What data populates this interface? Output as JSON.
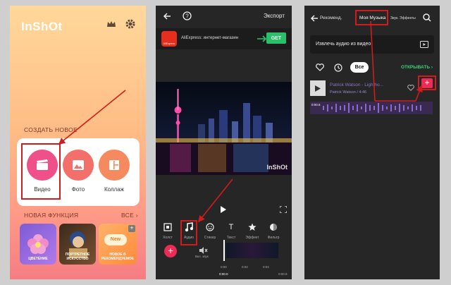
{
  "panel1": {
    "logo": "InShOt",
    "section_create": "СОЗДАТЬ НОВОЕ",
    "buttons": [
      {
        "label": "Видео"
      },
      {
        "label": "Фото"
      },
      {
        "label": "Коллаж"
      }
    ],
    "section_new": "НОВАЯ ФУНКЦИЯ",
    "see_all": "ВСЕ",
    "features": [
      {
        "label": "ЦВЕТЕНИЕ"
      },
      {
        "label": "ПОРТРЕТНОЕ ИСКУССТВО"
      },
      {
        "label": "НОВОЕ В РЕКОМЕНДУЕМОЕ",
        "badge": "New"
      }
    ]
  },
  "panel2": {
    "export_label": "Экспорт",
    "ad": {
      "text": "AliExpress: интернет-магазин",
      "cta": "GET",
      "logo_text": "AliExpress"
    },
    "watermark": "InShOt",
    "tools": [
      {
        "label": "Холст"
      },
      {
        "label": "Аудио"
      },
      {
        "label": "Стикер"
      },
      {
        "label": "Текст",
        "glyph": "T"
      },
      {
        "label": "Эффект"
      },
      {
        "label": "Фильтр"
      }
    ],
    "timeline": {
      "mute_label": "Вкл. звук",
      "ruler": [
        "0:00",
        "0:02",
        "0:04"
      ],
      "current_time": "0:00.0",
      "end_time": "0:00.9"
    }
  },
  "panel3": {
    "tabs": [
      {
        "label": "Рекоменд."
      },
      {
        "label": "Моя Музыка"
      },
      {
        "label": "Звук. Эффекты"
      }
    ],
    "extract_label": "Извлечь аудио из видео",
    "filter_all": "Все",
    "open_label": "ОТКРЫВАТЬ",
    "track": {
      "title": "Patrick Watson - Lightho...",
      "subtitle": "Patrick Watson / 4:46"
    },
    "wave_time": "0:00.6"
  },
  "colors": {
    "accent_red": "#d01c1c",
    "pink": "#ee2b55",
    "green": "#3ed07a"
  }
}
